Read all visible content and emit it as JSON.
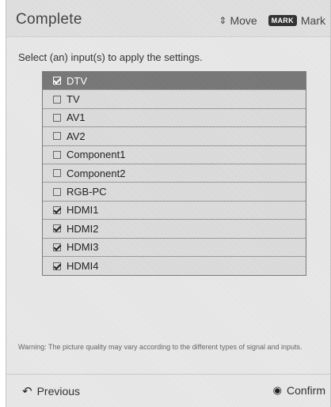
{
  "header": {
    "title": "Complete",
    "move_label": "Move",
    "mark_badge": "MARK",
    "mark_label": "Mark"
  },
  "instruction": "Select (an) input(s) to apply the settings.",
  "inputs": [
    {
      "label": "DTV",
      "checked": true,
      "selected": true
    },
    {
      "label": "TV",
      "checked": false,
      "selected": false
    },
    {
      "label": "AV1",
      "checked": false,
      "selected": false
    },
    {
      "label": "AV2",
      "checked": false,
      "selected": false
    },
    {
      "label": "Component1",
      "checked": false,
      "selected": false
    },
    {
      "label": "Component2",
      "checked": false,
      "selected": false
    },
    {
      "label": "RGB-PC",
      "checked": false,
      "selected": false
    },
    {
      "label": "HDMI1",
      "checked": true,
      "selected": false
    },
    {
      "label": "HDMI2",
      "checked": true,
      "selected": false
    },
    {
      "label": "HDMI3",
      "checked": true,
      "selected": false
    },
    {
      "label": "HDMI4",
      "checked": true,
      "selected": false
    }
  ],
  "warning": "Warning: The picture quality may vary according to the different types of signal and inputs.",
  "footer": {
    "previous_label": "Previous",
    "confirm_label": "Confirm"
  },
  "icons": {
    "move": "up-down-arrow-icon",
    "previous": "back-arrow-icon",
    "confirm": "ok-button-icon"
  }
}
